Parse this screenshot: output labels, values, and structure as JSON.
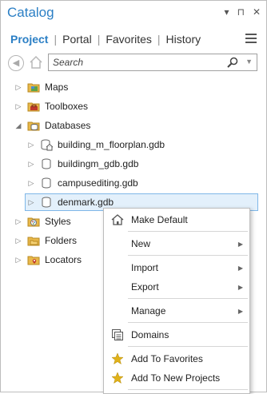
{
  "pane": {
    "title": "Catalog",
    "controls": [
      "▾",
      "⊓",
      "✕"
    ]
  },
  "tabs": [
    {
      "label": "Project",
      "active": true
    },
    {
      "label": "Portal"
    },
    {
      "label": "Favorites"
    },
    {
      "label": "History"
    }
  ],
  "search": {
    "placeholder": "Search"
  },
  "tree": {
    "items": [
      {
        "label": "Maps",
        "icon": "maps-folder-icon"
      },
      {
        "label": "Toolboxes",
        "icon": "toolboxes-folder-icon"
      },
      {
        "label": "Databases",
        "icon": "databases-folder-icon",
        "expanded": true
      },
      {
        "label": "building_m_floorplan.gdb",
        "icon": "home-database-icon"
      },
      {
        "label": "buildingm_gdb.gdb",
        "icon": "database-icon"
      },
      {
        "label": "campusediting.gdb",
        "icon": "database-icon"
      },
      {
        "label": "denmark.gdb",
        "icon": "database-icon",
        "selected": true
      },
      {
        "label": "Styles",
        "icon": "styles-folder-icon"
      },
      {
        "label": "Folders",
        "icon": "folders-folder-icon"
      },
      {
        "label": "Locators",
        "icon": "locators-folder-icon"
      }
    ]
  },
  "context_menu": {
    "items": [
      {
        "label": "Make Default",
        "icon": "home-icon"
      },
      {
        "label": "New",
        "submenu": true
      },
      {
        "label": "Import",
        "submenu": true
      },
      {
        "label": "Export",
        "submenu": true
      },
      {
        "label": "Manage",
        "submenu": true
      },
      {
        "label": "Domains",
        "icon": "domains-icon"
      },
      {
        "label": "Add To Favorites",
        "icon": "star-icon"
      },
      {
        "label": "Add To New Projects",
        "icon": "star-icon"
      }
    ]
  },
  "colors": {
    "accent": "#2b7fc5",
    "folder": "#e8b84a",
    "star": "#e0b21a"
  }
}
